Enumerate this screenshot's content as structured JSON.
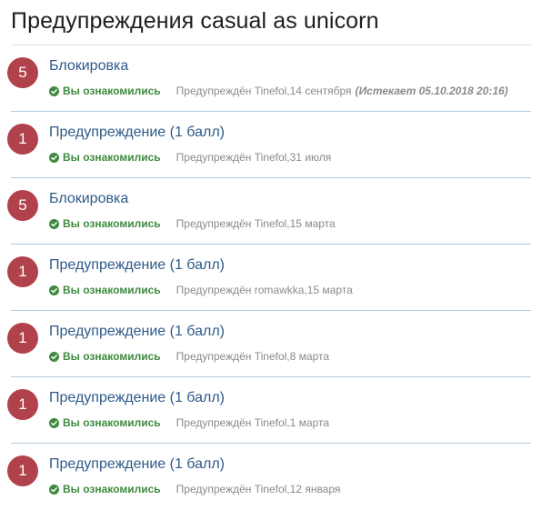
{
  "page": {
    "title": "Предупреждения casual as unicorn"
  },
  "colors": {
    "badge": "#b1414a",
    "title_link": "#2e5a8a",
    "acknowledged": "#3f8a3f",
    "meta_text": "#8a8a8a",
    "divider": "#b5c9dc"
  },
  "items": [
    {
      "points": "5",
      "title": "Блокировка",
      "status": "Вы ознакомились",
      "issued_by": "Предупреждён Tinefol,14 сентября",
      "expires": "(Истекает 05.10.2018 20:16)",
      "status_icon": "check-circle-icon"
    },
    {
      "points": "1",
      "title": "Предупреждение (1 балл)",
      "status": "Вы ознакомились",
      "issued_by": "Предупреждён Tinefol,31 июля",
      "expires": "",
      "status_icon": "check-circle-icon"
    },
    {
      "points": "5",
      "title": "Блокировка",
      "status": "Вы ознакомились",
      "issued_by": "Предупреждён Tinefol,15 марта",
      "expires": "",
      "status_icon": "check-circle-icon"
    },
    {
      "points": "1",
      "title": "Предупреждение (1 балл)",
      "status": "Вы ознакомились",
      "issued_by": "Предупреждён romawkka,15 марта",
      "expires": "",
      "status_icon": "check-circle-icon"
    },
    {
      "points": "1",
      "title": "Предупреждение (1 балл)",
      "status": "Вы ознакомились",
      "issued_by": "Предупреждён Tinefol,8 марта",
      "expires": "",
      "status_icon": "check-circle-icon"
    },
    {
      "points": "1",
      "title": "Предупреждение (1 балл)",
      "status": "Вы ознакомились",
      "issued_by": "Предупреждён Tinefol,1 марта",
      "expires": "",
      "status_icon": "check-circle-icon"
    },
    {
      "points": "1",
      "title": "Предупреждение (1 балл)",
      "status": "Вы ознакомились",
      "issued_by": "Предупреждён Tinefol,12 января",
      "expires": "",
      "status_icon": "check-circle-icon"
    }
  ]
}
